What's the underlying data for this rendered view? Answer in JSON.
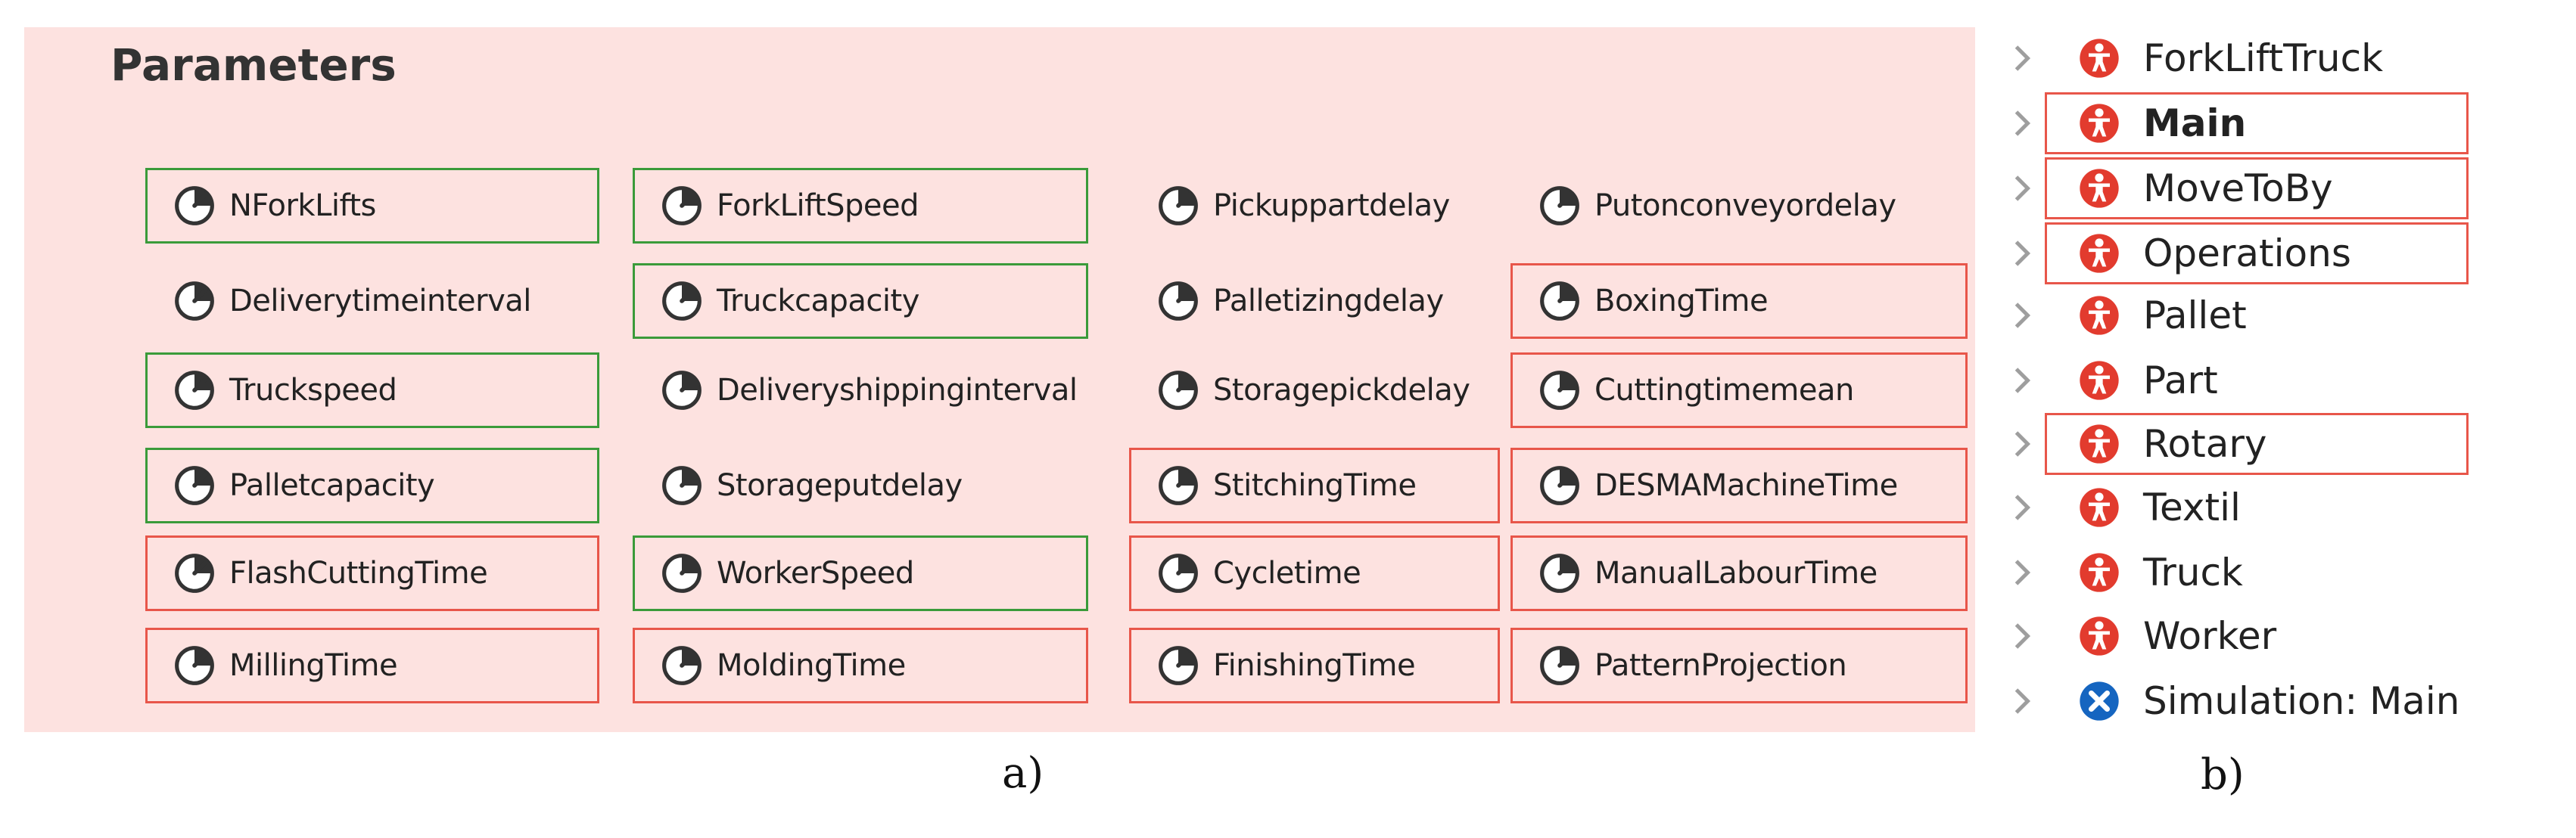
{
  "panel_a": {
    "title": "Parameters",
    "caption": "a)",
    "icon": "parameter-gauge-icon",
    "colors": {
      "background": "#fde2e0",
      "green_border": "#3a9b3a",
      "red_border": "#e8564a"
    },
    "parameters": [
      {
        "label": "NForkLifts",
        "border": "green"
      },
      {
        "label": "ForkLiftSpeed",
        "border": "green"
      },
      {
        "label": "Pickuppartdelay",
        "border": "none"
      },
      {
        "label": "Putonconveyordelay",
        "border": "none"
      },
      {
        "label": "Deliverytimeinterval",
        "border": "none"
      },
      {
        "label": "Truckcapacity",
        "border": "green"
      },
      {
        "label": "Palletizingdelay",
        "border": "none"
      },
      {
        "label": "BoxingTime",
        "border": "red"
      },
      {
        "label": "Truckspeed",
        "border": "green"
      },
      {
        "label": "Deliveryshippinginterval",
        "border": "none"
      },
      {
        "label": "Storagepickdelay",
        "border": "none"
      },
      {
        "label": "Cuttingtimemean",
        "border": "red"
      },
      {
        "label": "Palletcapacity",
        "border": "green"
      },
      {
        "label": "Storageputdelay",
        "border": "none"
      },
      {
        "label": "StitchingTime",
        "border": "red"
      },
      {
        "label": "DESMAMachineTime",
        "border": "red"
      },
      {
        "label": "FlashCuttingTime",
        "border": "red"
      },
      {
        "label": "WorkerSpeed",
        "border": "green"
      },
      {
        "label": "Cycletime",
        "border": "red"
      },
      {
        "label": "ManualLabourTime",
        "border": "red"
      },
      {
        "label": "MillingTime",
        "border": "red"
      },
      {
        "label": "MoldingTime",
        "border": "red"
      },
      {
        "label": "FinishingTime",
        "border": "red"
      },
      {
        "label": "PatternProjection",
        "border": "red"
      }
    ]
  },
  "panel_b": {
    "caption": "b)",
    "colors": {
      "agent_icon": "#e23b2e",
      "simulation_icon": "#1565c0",
      "chevron": "#9e9e9e",
      "highlight_border": "#e8564a"
    },
    "items": [
      {
        "label": "ForkLiftTruck",
        "icon": "agent-type-icon",
        "bold": false,
        "highlighted": false
      },
      {
        "label": "Main",
        "icon": "agent-type-icon",
        "bold": true,
        "highlighted": true
      },
      {
        "label": "MoveToBy",
        "icon": "agent-type-icon",
        "bold": false,
        "highlighted": true
      },
      {
        "label": "Operations",
        "icon": "agent-type-icon",
        "bold": false,
        "highlighted": true
      },
      {
        "label": "Pallet",
        "icon": "agent-type-icon",
        "bold": false,
        "highlighted": false
      },
      {
        "label": "Part",
        "icon": "agent-type-icon",
        "bold": false,
        "highlighted": false
      },
      {
        "label": "Rotary",
        "icon": "agent-type-icon",
        "bold": false,
        "highlighted": true
      },
      {
        "label": "Textil",
        "icon": "agent-type-icon",
        "bold": false,
        "highlighted": false
      },
      {
        "label": "Truck",
        "icon": "agent-type-icon",
        "bold": false,
        "highlighted": false
      },
      {
        "label": "Worker",
        "icon": "agent-type-icon",
        "bold": false,
        "highlighted": false
      },
      {
        "label": "Simulation: Main",
        "icon": "simulation-experiment-icon",
        "bold": false,
        "highlighted": false
      }
    ]
  }
}
